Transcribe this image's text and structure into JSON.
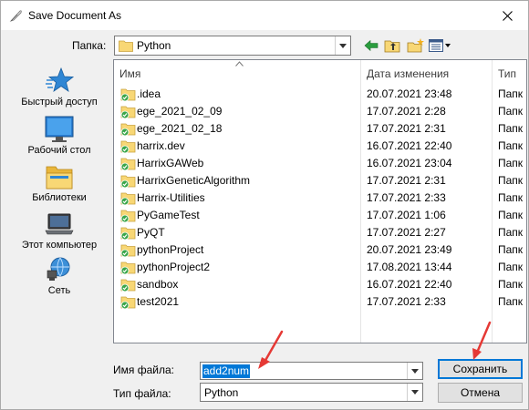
{
  "window": {
    "title": "Save Document As"
  },
  "folder_bar": {
    "label": "Папка:",
    "current": "Python"
  },
  "places": [
    {
      "label": "Быстрый доступ",
      "icon": "star-icon"
    },
    {
      "label": "Рабочий стол",
      "icon": "desktop-icon"
    },
    {
      "label": "Библиотеки",
      "icon": "libraries-icon"
    },
    {
      "label": "Этот компьютер",
      "icon": "computer-icon"
    },
    {
      "label": "Сеть",
      "icon": "network-icon"
    }
  ],
  "columns": {
    "name": "Имя",
    "date": "Дата изменения",
    "type": "Тип"
  },
  "files": [
    {
      "name": ".idea",
      "date": "20.07.2021 23:48",
      "type": "Папк"
    },
    {
      "name": "ege_2021_02_09",
      "date": "17.07.2021 2:28",
      "type": "Папк"
    },
    {
      "name": "ege_2021_02_18",
      "date": "17.07.2021 2:31",
      "type": "Папк"
    },
    {
      "name": "harrix.dev",
      "date": "16.07.2021 22:40",
      "type": "Папк"
    },
    {
      "name": "HarrixGAWeb",
      "date": "16.07.2021 23:04",
      "type": "Папк"
    },
    {
      "name": "HarrixGeneticAlgorithm",
      "date": "17.07.2021 2:31",
      "type": "Папк"
    },
    {
      "name": "Harrix-Utilities",
      "date": "17.07.2021 2:33",
      "type": "Папк"
    },
    {
      "name": "PyGameTest",
      "date": "17.07.2021 1:06",
      "type": "Папк"
    },
    {
      "name": "PyQT",
      "date": "17.07.2021 2:27",
      "type": "Папк"
    },
    {
      "name": "pythonProject",
      "date": "20.07.2021 23:49",
      "type": "Папк"
    },
    {
      "name": "pythonProject2",
      "date": "17.08.2021 13:44",
      "type": "Папк"
    },
    {
      "name": "sandbox",
      "date": "16.07.2021 22:40",
      "type": "Папк"
    },
    {
      "name": "test2021",
      "date": "17.07.2021 2:33",
      "type": "Папк"
    }
  ],
  "filename": {
    "label": "Имя файла:",
    "value": "add2num"
  },
  "filetype": {
    "label": "Тип файла:",
    "value": "Python"
  },
  "buttons": {
    "save": "Сохранить",
    "cancel": "Отмена"
  },
  "colors": {
    "accent": "#0078d7",
    "annotation": "#e53935",
    "folder": "#f8d775"
  }
}
